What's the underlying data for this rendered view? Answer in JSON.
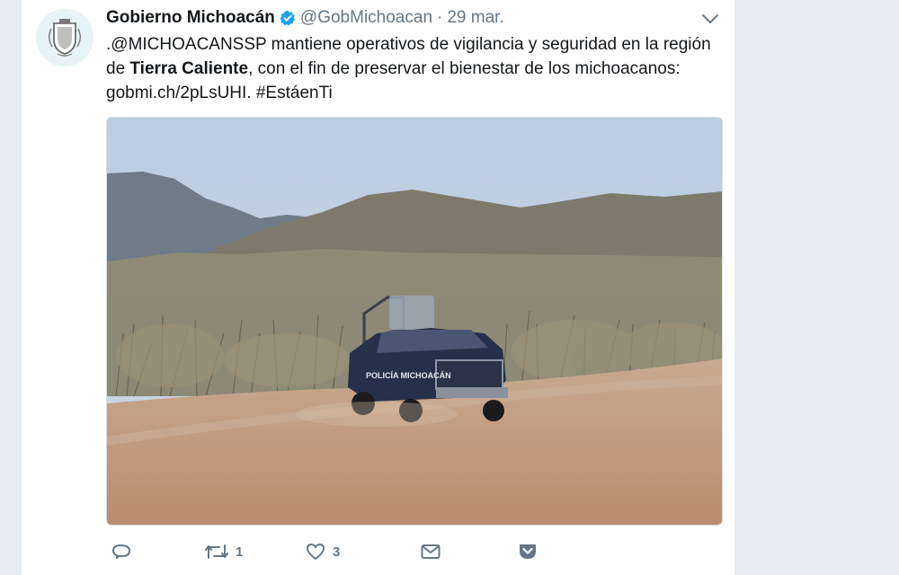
{
  "tweet": {
    "display_name": "Gobierno Michoacán",
    "handle": "@GobMichoacan",
    "separator": "·",
    "date": "29 mar.",
    "text_line1": ".@MICHOACANSSP mantiene operativos de vigilancia y seguridad en la región",
    "text_line2_pre": "de ",
    "text_line2_bold": "Tierra Caliente",
    "text_line2_post": ", con el fin de preservar el bienestar de los michoacanos:",
    "text_line3": "gobmi.ch/2pLsUHI. #EstáenTi",
    "photo_vehicle_text": "POLICÍA MICHOACÁN",
    "actions": {
      "reply_count": "",
      "retweet_count": "1",
      "like_count": "3"
    }
  },
  "icons": {
    "verified": "verified-badge-icon",
    "caret": "chevron-down-icon",
    "reply": "reply-icon",
    "retweet": "retweet-icon",
    "like": "heart-icon",
    "dm": "envelope-icon",
    "save": "pocket-icon"
  },
  "colors": {
    "verified_blue": "#1da1f2",
    "muted": "#657786",
    "text": "#14171a",
    "pocket_red": "#657786"
  }
}
